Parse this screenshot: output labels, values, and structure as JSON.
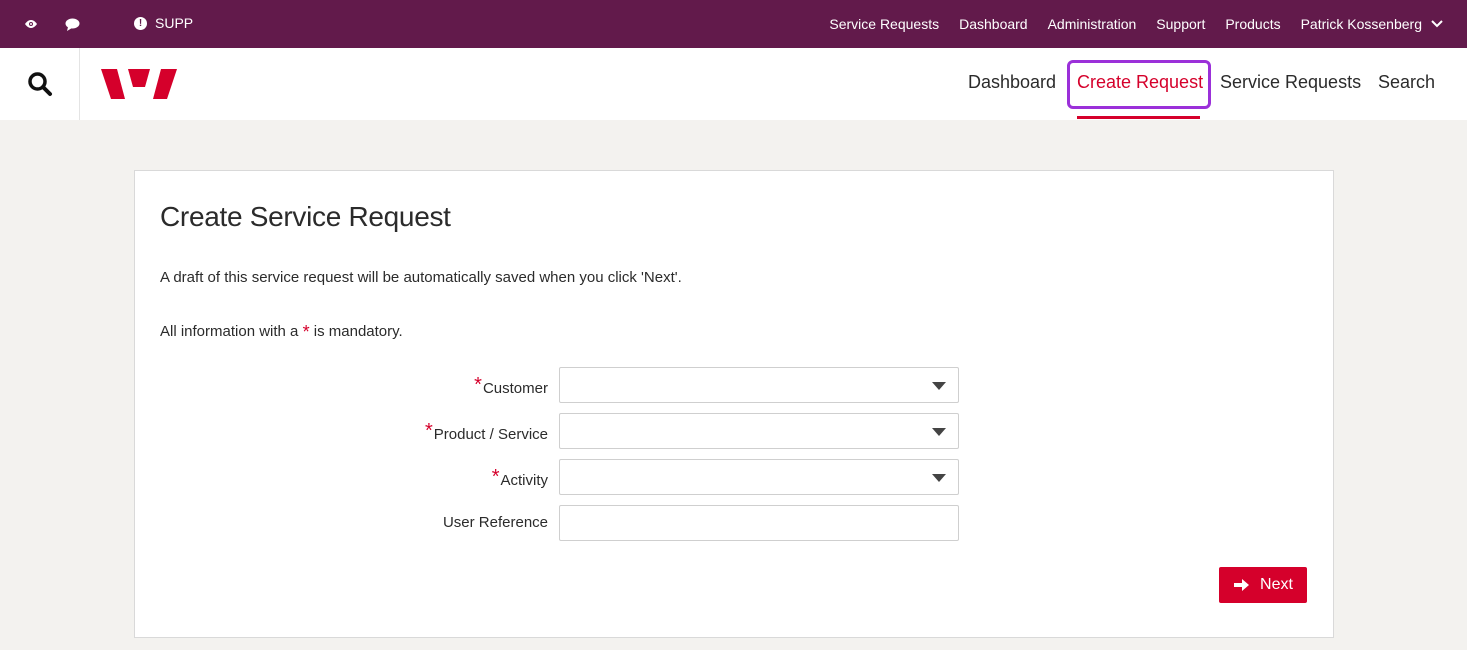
{
  "topbar": {
    "env_label": "SUPP",
    "links": [
      "Service Requests",
      "Dashboard",
      "Administration",
      "Support",
      "Products"
    ],
    "user_name": "Patrick Kossenberg"
  },
  "header": {
    "nav": {
      "dashboard": "Dashboard",
      "create_request": "Create Request",
      "service_requests": "Service Requests",
      "search": "Search"
    },
    "active_nav": "Create Request"
  },
  "form": {
    "title": "Create Service Request",
    "note": "A draft of this service request will be automatically saved when you click 'Next'.",
    "mandatory_prefix": "All information with a",
    "mandatory_star": "*",
    "mandatory_suffix": "is mandatory.",
    "fields": [
      {
        "label": "Customer",
        "required": true,
        "type": "select",
        "value": ""
      },
      {
        "label": "Product / Service",
        "required": true,
        "type": "select",
        "value": ""
      },
      {
        "label": "Activity",
        "required": true,
        "type": "select",
        "value": ""
      },
      {
        "label": "User Reference",
        "required": false,
        "type": "text",
        "value": ""
      }
    ],
    "next_label": "Next"
  },
  "colors": {
    "topbar": "#621a4b",
    "brand_red": "#d5002b",
    "highlight": "#9b30d9",
    "page_bg": "#f3f2ef"
  },
  "icons": [
    "eye-icon",
    "chat-icon",
    "alert-icon",
    "chevron-down-icon",
    "search-icon",
    "westpac-logo",
    "arrow-right-icon"
  ]
}
